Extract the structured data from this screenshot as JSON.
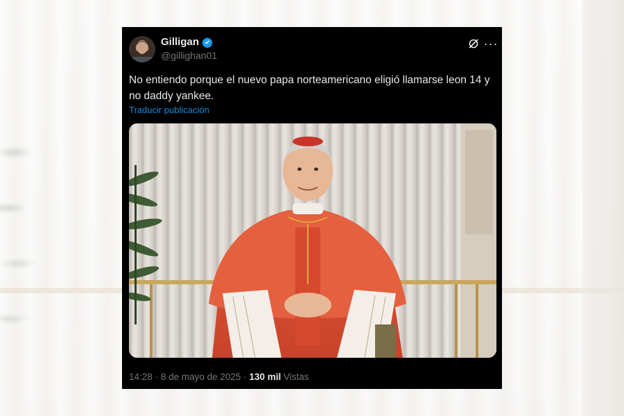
{
  "tweet": {
    "display_name": "Gilligan",
    "handle": "@gillighan01",
    "text": "No entiendo porque el nuevo papa norteamericano eligió llamarse leon 14 y no daddy yankee.",
    "translate_label": "Traducir publicación",
    "time": "14:28",
    "separator": "·",
    "date": "8 de mayo de 2025",
    "views_count": "130 mil",
    "views_label": "Vistas"
  },
  "icons": {
    "verified": "verified-badge-icon",
    "grok": "grok-icon",
    "more": "more-icon"
  },
  "colors": {
    "card_bg": "#000000",
    "text_primary": "#e7e9ea",
    "text_secondary": "#71767b",
    "link": "#1d9bf0",
    "verified": "#1d9bf0"
  }
}
